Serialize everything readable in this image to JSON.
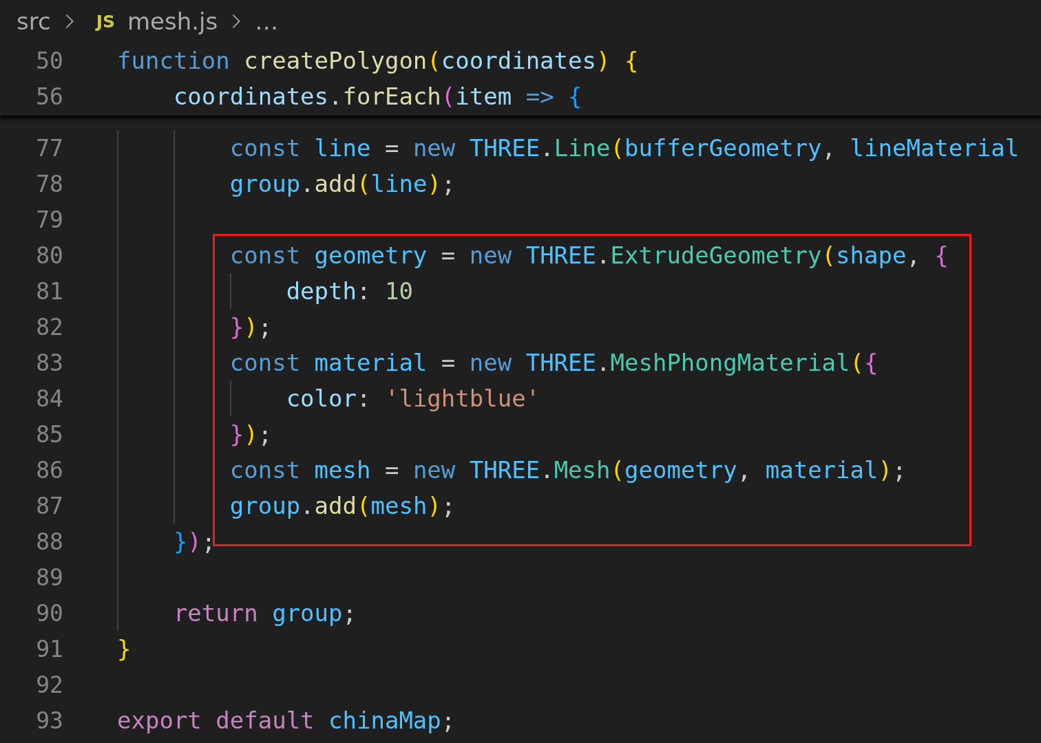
{
  "breadcrumb": {
    "folder": "src",
    "file_icon": "JS",
    "file": "mesh.js",
    "more": "…"
  },
  "sticky_lines": [
    {
      "kind": "line",
      "number": "50",
      "tokens": [
        {
          "kind": "kw",
          "t": "function "
        },
        {
          "kind": "fn",
          "t": "createPolygon"
        },
        {
          "kind": "b1",
          "t": "("
        },
        {
          "kind": "param",
          "t": "coordinates"
        },
        {
          "kind": "b1",
          "t": ") {"
        }
      ]
    },
    {
      "kind": "block",
      "children": [
        {
          "kind": "line",
          "number": "56",
          "tokens": [
            {
              "kind": "param",
              "t": "coordinates"
            },
            {
              "kind": "p",
              "t": "."
            },
            {
              "kind": "fn",
              "t": "forEach"
            },
            {
              "kind": "b2",
              "t": "("
            },
            {
              "kind": "param",
              "t": "item "
            },
            {
              "kind": "kw",
              "t": "=> "
            },
            {
              "kind": "b3",
              "t": "{"
            }
          ]
        }
      ]
    }
  ],
  "lines": [
    {
      "kind": "block",
      "children": [
        {
          "kind": "block",
          "children": [
            {
              "kind": "line",
              "number": "77",
              "tokens": [
                {
                  "kind": "kw",
                  "t": "const "
                },
                {
                  "kind": "var",
                  "t": "line "
                },
                {
                  "kind": "p",
                  "t": "= "
                },
                {
                  "kind": "kw",
                  "t": "new "
                },
                {
                  "kind": "var",
                  "t": "THREE"
                },
                {
                  "kind": "p",
                  "t": "."
                },
                {
                  "kind": "cls",
                  "t": "Line"
                },
                {
                  "kind": "b1",
                  "t": "("
                },
                {
                  "kind": "var",
                  "t": "bufferGeometry"
                },
                {
                  "kind": "p",
                  "t": ", "
                },
                {
                  "kind": "var",
                  "t": "lineMaterial"
                }
              ]
            },
            {
              "kind": "line",
              "number": "78",
              "tokens": [
                {
                  "kind": "var",
                  "t": "group"
                },
                {
                  "kind": "p",
                  "t": "."
                },
                {
                  "kind": "fn",
                  "t": "add"
                },
                {
                  "kind": "b1",
                  "t": "("
                },
                {
                  "kind": "var",
                  "t": "line"
                },
                {
                  "kind": "b1",
                  "t": ")"
                },
                {
                  "kind": "p",
                  "t": ";"
                }
              ]
            },
            {
              "kind": "line",
              "number": "79"
            },
            {
              "kind": "highlight",
              "children": [
                {
                  "kind": "line",
                  "number": "80",
                  "tokens": [
                    {
                      "kind": "kw",
                      "t": "const "
                    },
                    {
                      "kind": "var",
                      "t": "geometry "
                    },
                    {
                      "kind": "p",
                      "t": "= "
                    },
                    {
                      "kind": "kw",
                      "t": "new "
                    },
                    {
                      "kind": "var",
                      "t": "THREE"
                    },
                    {
                      "kind": "p",
                      "t": "."
                    },
                    {
                      "kind": "cls",
                      "t": "ExtrudeGeometry"
                    },
                    {
                      "kind": "b1",
                      "t": "("
                    },
                    {
                      "kind": "var",
                      "t": "shape"
                    },
                    {
                      "kind": "p",
                      "t": ", "
                    },
                    {
                      "kind": "b2",
                      "t": "{"
                    }
                  ]
                },
                {
                  "kind": "block",
                  "children": [
                    {
                      "kind": "line",
                      "number": "81",
                      "tokens": [
                        {
                          "kind": "param",
                          "t": "depth"
                        },
                        {
                          "kind": "p",
                          "t": ": "
                        },
                        {
                          "kind": "num",
                          "t": "10"
                        }
                      ]
                    }
                  ]
                },
                {
                  "kind": "line",
                  "number": "82",
                  "tokens": [
                    {
                      "kind": "b2",
                      "t": "}"
                    },
                    {
                      "kind": "b1",
                      "t": ")"
                    },
                    {
                      "kind": "p",
                      "t": ";"
                    }
                  ]
                },
                {
                  "kind": "line",
                  "number": "83",
                  "tokens": [
                    {
                      "kind": "kw",
                      "t": "const "
                    },
                    {
                      "kind": "var",
                      "t": "material "
                    },
                    {
                      "kind": "p",
                      "t": "= "
                    },
                    {
                      "kind": "kw",
                      "t": "new "
                    },
                    {
                      "kind": "var",
                      "t": "THREE"
                    },
                    {
                      "kind": "p",
                      "t": "."
                    },
                    {
                      "kind": "cls",
                      "t": "MeshPhongMaterial"
                    },
                    {
                      "kind": "b1",
                      "t": "("
                    },
                    {
                      "kind": "b2",
                      "t": "{"
                    }
                  ]
                },
                {
                  "kind": "block",
                  "children": [
                    {
                      "kind": "line",
                      "number": "84",
                      "tokens": [
                        {
                          "kind": "param",
                          "t": "color"
                        },
                        {
                          "kind": "p",
                          "t": ": "
                        },
                        {
                          "kind": "str",
                          "t": "'lightblue'"
                        }
                      ]
                    }
                  ]
                },
                {
                  "kind": "line",
                  "number": "85",
                  "tokens": [
                    {
                      "kind": "b2",
                      "t": "}"
                    },
                    {
                      "kind": "b1",
                      "t": ")"
                    },
                    {
                      "kind": "p",
                      "t": ";"
                    }
                  ]
                },
                {
                  "kind": "line",
                  "number": "86",
                  "tokens": [
                    {
                      "kind": "kw",
                      "t": "const "
                    },
                    {
                      "kind": "var",
                      "t": "mesh "
                    },
                    {
                      "kind": "p",
                      "t": "= "
                    },
                    {
                      "kind": "kw",
                      "t": "new "
                    },
                    {
                      "kind": "var",
                      "t": "THREE"
                    },
                    {
                      "kind": "p",
                      "t": "."
                    },
                    {
                      "kind": "cls",
                      "t": "Mesh"
                    },
                    {
                      "kind": "b1",
                      "t": "("
                    },
                    {
                      "kind": "var",
                      "t": "geometry"
                    },
                    {
                      "kind": "p",
                      "t": ", "
                    },
                    {
                      "kind": "var",
                      "t": "material"
                    },
                    {
                      "kind": "b1",
                      "t": ")"
                    },
                    {
                      "kind": "p",
                      "t": ";"
                    }
                  ]
                },
                {
                  "kind": "line",
                  "number": "87",
                  "tokens": [
                    {
                      "kind": "var",
                      "t": "group"
                    },
                    {
                      "kind": "p",
                      "t": "."
                    },
                    {
                      "kind": "fn",
                      "t": "add"
                    },
                    {
                      "kind": "b1",
                      "t": "("
                    },
                    {
                      "kind": "var",
                      "t": "mesh"
                    },
                    {
                      "kind": "b1",
                      "t": ")"
                    },
                    {
                      "kind": "p",
                      "t": ";"
                    }
                  ]
                }
              ]
            }
          ]
        },
        {
          "kind": "line",
          "number": "88",
          "tokens": [
            {
              "kind": "b3",
              "t": "}"
            },
            {
              "kind": "b2",
              "t": ")"
            },
            {
              "kind": "p",
              "t": ";"
            }
          ]
        },
        {
          "kind": "line",
          "number": "89"
        },
        {
          "kind": "line",
          "number": "90",
          "tokens": [
            {
              "kind": "ctl",
              "t": "return "
            },
            {
              "kind": "var",
              "t": "group"
            },
            {
              "kind": "p",
              "t": ";"
            }
          ]
        }
      ]
    },
    {
      "kind": "line",
      "number": "91",
      "tokens": [
        {
          "kind": "b1",
          "t": "}"
        }
      ]
    },
    {
      "kind": "line",
      "number": "92"
    },
    {
      "kind": "line",
      "number": "93",
      "tokens": [
        {
          "kind": "ctl",
          "t": "export default "
        },
        {
          "kind": "var",
          "t": "chinaMap"
        },
        {
          "kind": "p",
          "t": ";"
        }
      ]
    }
  ]
}
